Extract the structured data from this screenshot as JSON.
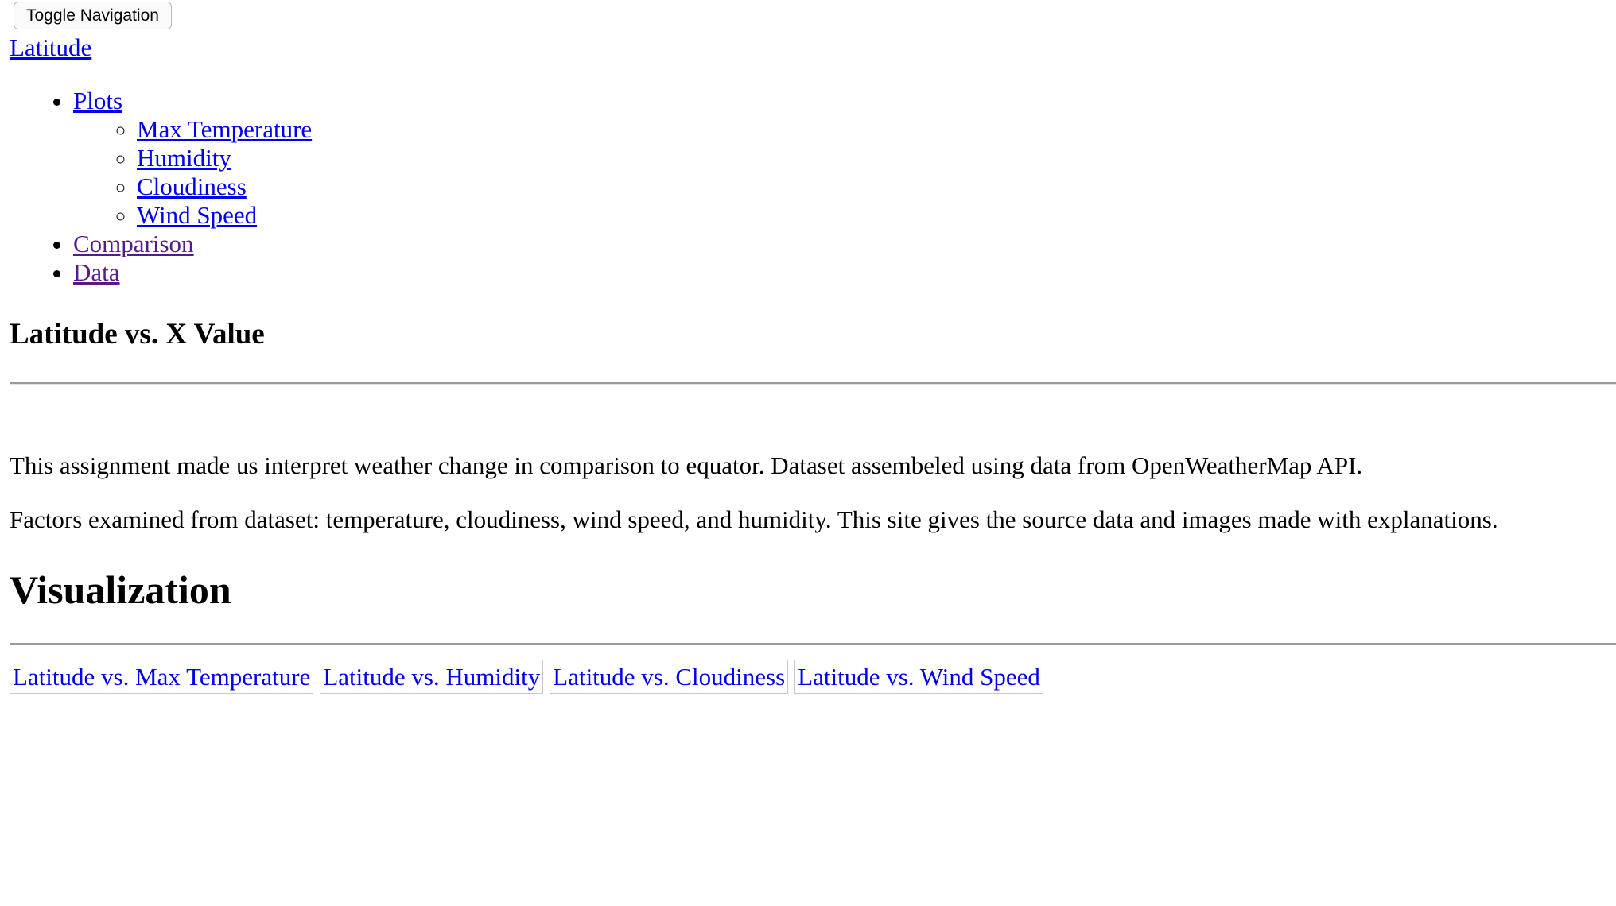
{
  "navbar": {
    "toggle_label": "Toggle Navigation",
    "brand": "Latitude",
    "items": [
      {
        "label": "Plots",
        "subitems": [
          "Max Temperature",
          "Humidity",
          "Cloudiness",
          "Wind Speed"
        ]
      },
      {
        "label": "Comparison"
      },
      {
        "label": "Data"
      }
    ]
  },
  "hero": {
    "title": "Latitude vs. X Value"
  },
  "intro": {
    "paragraph_1": "This assignment made us interpret weather change in comparison to equator. Dataset assembeled using data from OpenWeatherMap API.",
    "paragraph_2": "Factors examined from dataset: temperature, cloudiness, wind speed, and humidity. This site gives the source data and images made with explanations."
  },
  "visualization": {
    "title": "Visualization",
    "tabs": [
      "Latitude vs. Max Temperature",
      "Latitude vs. Humidity",
      "Latitude vs. Cloudiness",
      "Latitude vs. Wind Speed"
    ]
  },
  "colors": {
    "link": "#0000ee",
    "visited_link": "#551a8b"
  }
}
